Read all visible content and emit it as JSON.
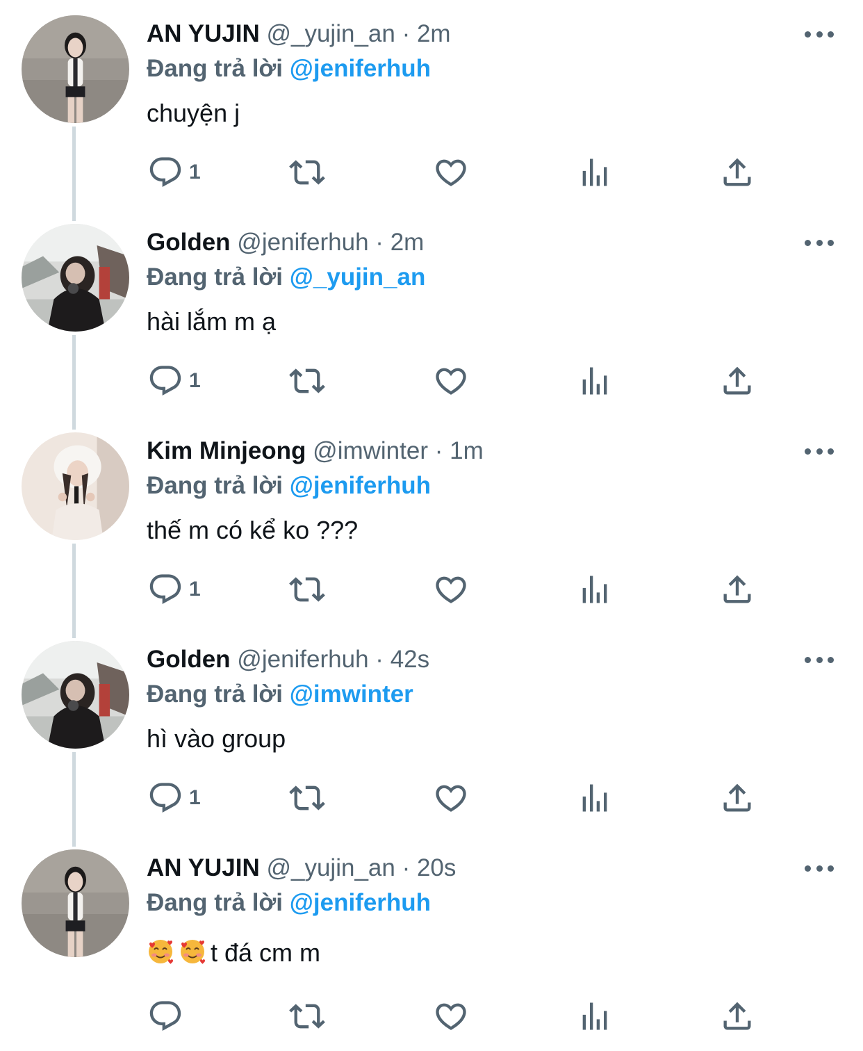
{
  "colors": {
    "accent": "#1d9bf0",
    "secondary_text": "#536471",
    "primary_text": "#0f1419",
    "thread_line": "#cfd9de"
  },
  "tweets": [
    {
      "name": "AN YUJIN",
      "handle": "@_yujin_an",
      "separator": "·",
      "time": "2m",
      "reply_prefix": "Đang trả lời",
      "reply_to": "@jeniferhuh",
      "text": "chuyện j",
      "reply_count": "1",
      "avatar": "avatar-yujin"
    },
    {
      "name": "Golden",
      "handle": "@jeniferhuh",
      "separator": "·",
      "time": "2m",
      "reply_prefix": "Đang trả lời",
      "reply_to": "@_yujin_an",
      "text": "hài lắm m ạ",
      "reply_count": "1",
      "avatar": "avatar-golden"
    },
    {
      "name": "Kim Minjeong",
      "handle": "@imwinter",
      "separator": "·",
      "time": "1m",
      "reply_prefix": "Đang trả lời",
      "reply_to": "@jeniferhuh",
      "text": "thế m có kể ko ???",
      "reply_count": "1",
      "avatar": "avatar-minjeong"
    },
    {
      "name": "Golden",
      "handle": "@jeniferhuh",
      "separator": "·",
      "time": "42s",
      "reply_prefix": "Đang trả lời",
      "reply_to": "@imwinter",
      "text": "hì vào group",
      "reply_count": "1",
      "avatar": "avatar-golden"
    },
    {
      "name": "AN YUJIN",
      "handle": "@_yujin_an",
      "separator": "·",
      "time": "20s",
      "reply_prefix": "Đang trả lời",
      "reply_to": "@jeniferhuh",
      "text": "t đá cm m",
      "emojis": [
        "smiling-face-with-hearts",
        "smiling-face-with-hearts"
      ],
      "reply_count": "",
      "avatar": "avatar-yujin"
    }
  ],
  "icons": {
    "reply": "reply-icon",
    "retweet": "retweet-icon",
    "like": "like-icon",
    "views": "views-icon",
    "share": "share-icon",
    "more": "more-icon"
  }
}
